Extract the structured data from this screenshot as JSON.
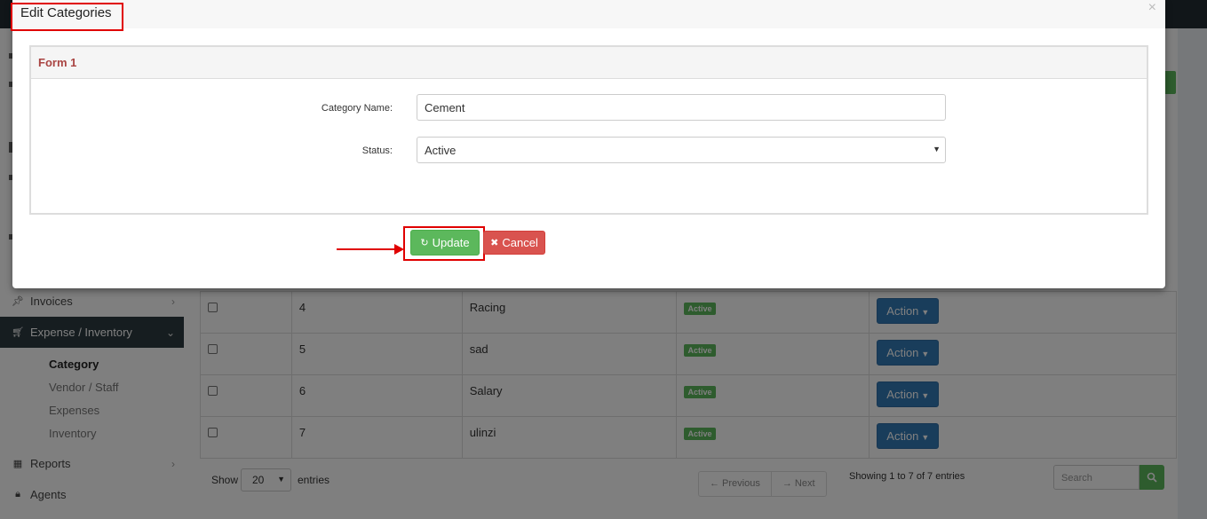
{
  "sidebar": {
    "items": [
      {
        "label": "Invoices",
        "icon": "pin-icon"
      },
      {
        "label": "Expense / Inventory",
        "icon": "cart-icon",
        "active": true
      },
      {
        "label": "Reports",
        "icon": "table-icon"
      },
      {
        "label": "Agents",
        "icon": "lock-icon"
      }
    ],
    "subitems": [
      {
        "label": "Category",
        "current": true
      },
      {
        "label": "Vendor / Staff"
      },
      {
        "label": "Expenses"
      },
      {
        "label": "Inventory"
      }
    ]
  },
  "table": {
    "rows": [
      {
        "id": "4",
        "name": "Racing",
        "status": "Active",
        "action": "Action"
      },
      {
        "id": "5",
        "name": "sad",
        "status": "Active",
        "action": "Action"
      },
      {
        "id": "6",
        "name": "Salary",
        "status": "Active",
        "action": "Action"
      },
      {
        "id": "7",
        "name": "ulinzi",
        "status": "Active",
        "action": "Action"
      }
    ]
  },
  "footer": {
    "show_label": "Show",
    "page_size": "20",
    "entries_label": "entries",
    "previous": "← Previous",
    "next": "→ Next",
    "info": "Showing 1 to 7 of 7 entries",
    "search_placeholder": "Search"
  },
  "modal": {
    "title": "Edit Categories",
    "close": "×",
    "panel_title": "Form 1",
    "fields": {
      "category_label": "Category Name:",
      "category_value": "Cement",
      "status_label": "Status:",
      "status_value": "Active"
    },
    "update_label": "Update",
    "cancel_label": "Cancel"
  },
  "colors": {
    "accent_red": "#e00000",
    "success": "#5cb85c",
    "danger": "#d9534f",
    "primary": "#337ab7"
  }
}
